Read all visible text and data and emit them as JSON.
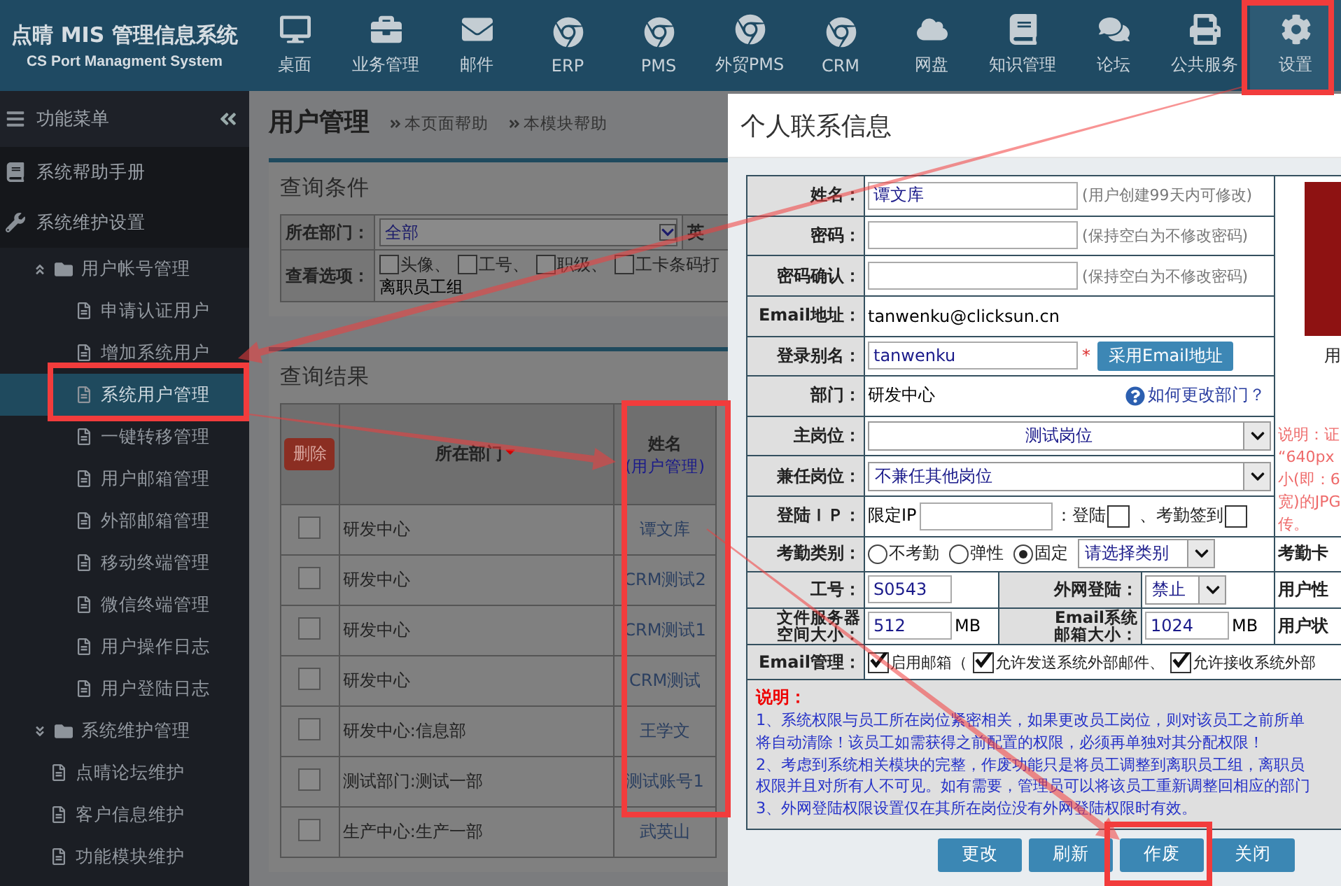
{
  "header": {
    "title": "点晴 MIS 管理信息系统",
    "subtitle": "CS Port Managment System",
    "nav": [
      {
        "label": "桌面",
        "kind": "monitor",
        "selected": false
      },
      {
        "label": "业务管理",
        "kind": "briefcase",
        "selected": false
      },
      {
        "label": "邮件",
        "kind": "mail",
        "selected": false
      },
      {
        "label": "ERP",
        "kind": "browser",
        "selected": false
      },
      {
        "label": "PMS",
        "kind": "browser",
        "selected": false
      },
      {
        "label": "外贸PMS",
        "kind": "browser",
        "selected": false
      },
      {
        "label": "CRM",
        "kind": "browser",
        "selected": false
      },
      {
        "label": "网盘",
        "kind": "cloud",
        "selected": false
      },
      {
        "label": "知识管理",
        "kind": "book",
        "selected": false
      },
      {
        "label": "论坛",
        "kind": "chat",
        "selected": false
      },
      {
        "label": "公共服务",
        "kind": "printer",
        "selected": false
      },
      {
        "label": "设置",
        "kind": "gear",
        "selected": true
      }
    ]
  },
  "sidebar": {
    "title": "功能菜单",
    "sections": [
      {
        "label": "系统帮助手册",
        "kind": "book"
      },
      {
        "label": "系统维护设置",
        "kind": "wrench"
      }
    ],
    "tree": [
      {
        "kind": "folder",
        "label": "用户帐号管理",
        "expanded": true,
        "children": [
          {
            "kind": "page",
            "label": "申请认证用户",
            "selected": false
          },
          {
            "kind": "page",
            "label": "增加系统用户",
            "selected": false
          },
          {
            "kind": "page",
            "label": "系统用户管理",
            "selected": true
          },
          {
            "kind": "page",
            "label": "一键转移管理",
            "selected": false
          },
          {
            "kind": "page",
            "label": "用户邮箱管理",
            "selected": false
          },
          {
            "kind": "page",
            "label": "外部邮箱管理",
            "selected": false
          },
          {
            "kind": "page",
            "label": "移动终端管理",
            "selected": false
          },
          {
            "kind": "page",
            "label": "微信终端管理",
            "selected": false
          },
          {
            "kind": "page",
            "label": "用户操作日志",
            "selected": false
          },
          {
            "kind": "page",
            "label": "用户登陆日志",
            "selected": false
          }
        ]
      },
      {
        "kind": "folder",
        "label": "系统维护管理",
        "expanded": false
      },
      {
        "kind": "page",
        "label": "点晴论坛维护",
        "selected": false
      },
      {
        "kind": "page",
        "label": "客户信息维护",
        "selected": false
      },
      {
        "kind": "page",
        "label": "功能模块维护",
        "selected": false
      }
    ]
  },
  "main": {
    "title": "用户管理",
    "links": [
      "本页面帮助",
      "本模块帮助"
    ],
    "query": {
      "title": "查询条件",
      "dept_label": "所在部门：",
      "dept_value": "全部",
      "column_3": "英",
      "options_label": "查看选项：",
      "options": [
        {
          "label": "头像、",
          "checked": false
        },
        {
          "label": "工号、",
          "checked": false
        },
        {
          "label": "职级、",
          "checked": false
        },
        {
          "label": "工卡条码打",
          "checked": false
        }
      ],
      "options_line2": "离职员工组"
    },
    "results": {
      "title": "查询结果",
      "delete": "删除",
      "dept_header": "所在部门",
      "name_header": "姓名",
      "name_sub": "(用户管理)",
      "rows": [
        {
          "dept": "研发中心",
          "name": "谭文库",
          "checked": false
        },
        {
          "dept": "研发中心",
          "name": "CRM测试2",
          "checked": false
        },
        {
          "dept": "研发中心",
          "name": "CRM测试1",
          "checked": false
        },
        {
          "dept": "研发中心",
          "name": "CRM测试",
          "checked": false
        },
        {
          "dept": "研发中心:信息部",
          "name": "王学文",
          "checked": false
        },
        {
          "dept": "测试部门:测试一部",
          "name": "测试账号1",
          "checked": false
        },
        {
          "dept": "生产中心:生产一部",
          "name": "武英山",
          "checked": false
        }
      ]
    }
  },
  "dialog": {
    "title": "个人联系信息",
    "form": [
      {
        "kind": "input",
        "label": "姓名：",
        "value": "谭文库",
        "hint": "(用户创建99天内可修改)"
      },
      {
        "kind": "input",
        "label": "密码：",
        "hint": "(保持空白为不修改密码)"
      },
      {
        "kind": "input",
        "label": "密码确认：",
        "hint": "(保持空白为不修改密码)"
      },
      {
        "kind": "text",
        "label": "Email地址：",
        "value": "tanwenku@clicksun.cn"
      },
      {
        "kind": "alias",
        "label": "登录别名：",
        "value": "tanwenku",
        "mark": "*",
        "button": "采用Email地址"
      },
      {
        "kind": "dept",
        "label": "部门：",
        "value": "研发中心",
        "link": "如何更改部门？"
      },
      {
        "kind": "select",
        "label": "主岗位：",
        "value": "测试岗位",
        "centered": true
      },
      {
        "kind": "select",
        "label": "兼任岗位：",
        "value": "不兼任其他岗位",
        "centered": false
      },
      {
        "kind": "ip",
        "label": "登陆ＩＰ：",
        "prefix": "限定IP",
        "checks": [
          {
            "label": "：登陆",
            "checked": false
          },
          {
            "label": "、考勤签到",
            "checked": false
          }
        ]
      },
      {
        "kind": "radios",
        "label": "考勤类别：",
        "options": [
          {
            "label": "不考勤",
            "selected": false
          },
          {
            "label": "弹性",
            "selected": false
          },
          {
            "label": "固定",
            "selected": true
          }
        ],
        "select": "请选择类别",
        "side": "考勤卡"
      },
      {
        "kind": "pair",
        "label": "工号：",
        "value": "S0543",
        "label2": "外网登陆：",
        "select2": "禁止",
        "side": "用户性"
      },
      {
        "kind": "sizes",
        "label": "文件服务器空间大小：",
        "value": "512",
        "unit": "MB",
        "label2": "Email系统邮箱大小：",
        "value2": "1024",
        "unit2": "MB",
        "side": "用户状"
      },
      {
        "kind": "checks",
        "label": "Email管理：",
        "checks": [
          {
            "label": "启用邮箱（",
            "checked": true
          },
          {
            "label": "允许发送系统外部邮件、",
            "checked": true
          },
          {
            "label": "允许接收系统外部",
            "checked": true
          }
        ]
      }
    ],
    "photo": {
      "caption": "用",
      "notes": [
        "说明：证",
        "“640px",
        "小(即：6",
        "宽)的JPG",
        "传。"
      ]
    },
    "notes": {
      "title": "说明：",
      "lines": [
        "1、系统权限与员工所在岗位紧密相关，如果更改员工岗位，则对该员工之前所单",
        "将自动清除！该员工如需获得之前配置的权限，必须再单独对其分配权限！",
        "2、考虑到系统相关模块的完整，作废功能只是将员工调整到离职员工组，离职员",
        "权限并且对所有人不可见。如有需要，管理员可以将该员工重新调整回相应的部门",
        "3、外网登陆权限设置仅在其所在岗位没有外网登陆权限时有效。"
      ]
    },
    "buttons": [
      "更改",
      "刷新",
      "作废",
      "关闭"
    ]
  }
}
